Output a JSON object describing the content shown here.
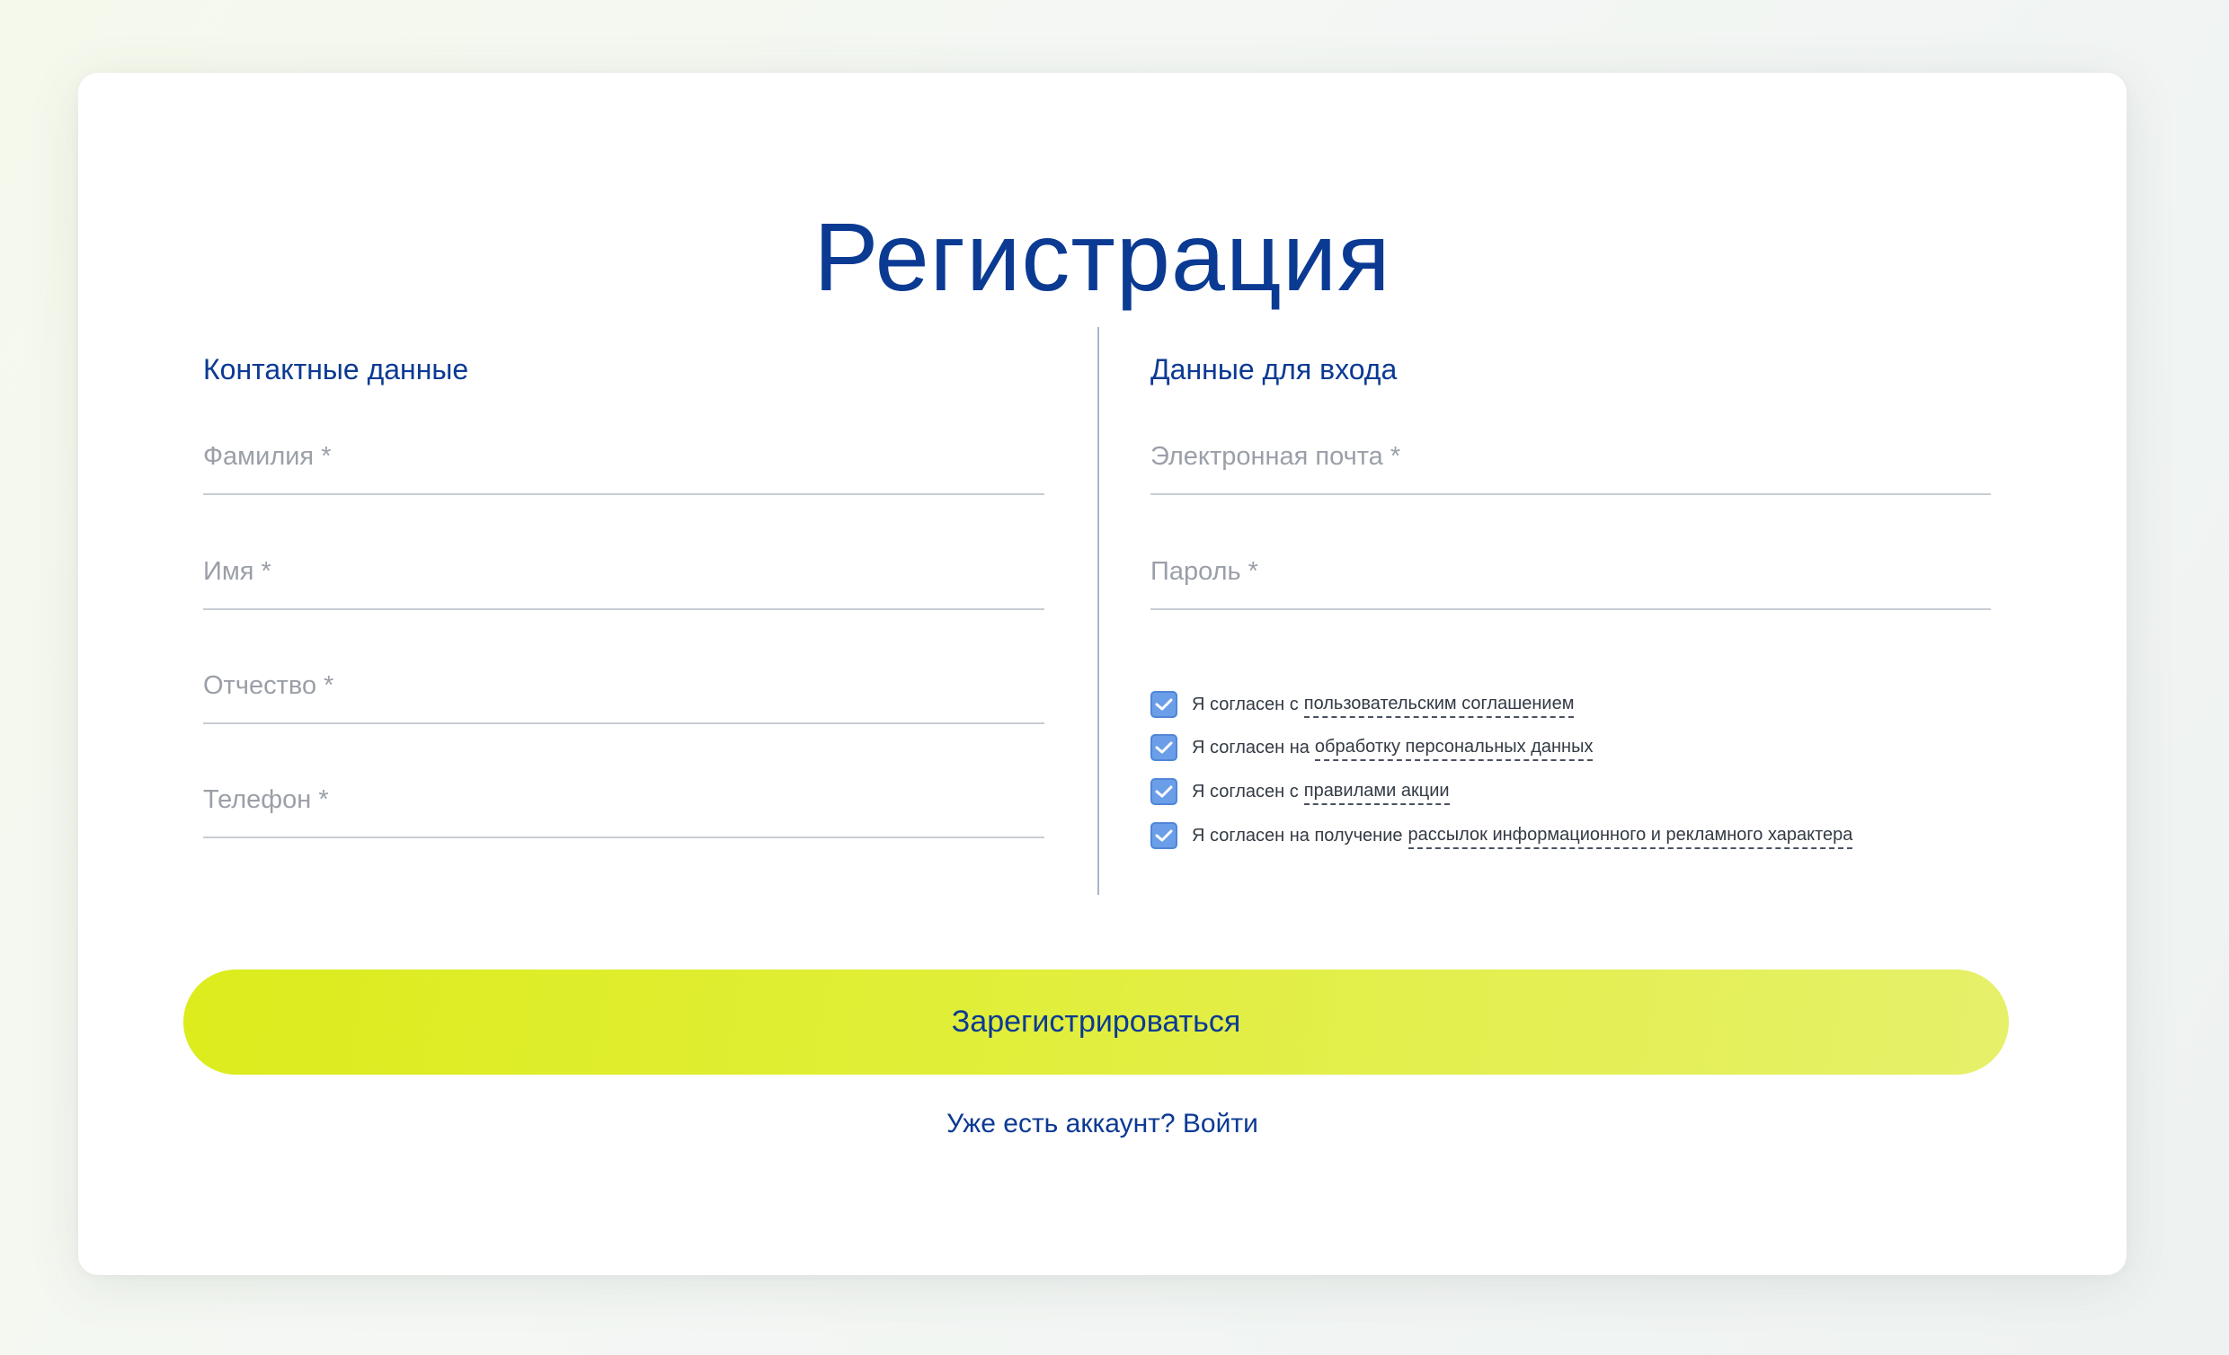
{
  "page": {
    "title": "Регистрация"
  },
  "contacts": {
    "heading": "Контактные данные",
    "fields": [
      {
        "placeholder": "Фамилия *",
        "value": ""
      },
      {
        "placeholder": "Имя *",
        "value": ""
      },
      {
        "placeholder": "Отчество *",
        "value": ""
      },
      {
        "placeholder": "Телефон *",
        "value": ""
      }
    ]
  },
  "login": {
    "heading": "Данные для входа",
    "fields": [
      {
        "placeholder": "Электронная почта *",
        "value": ""
      },
      {
        "placeholder": "Пароль *",
        "value": ""
      }
    ]
  },
  "agreements": [
    {
      "prefix": "Я согласен с",
      "link": "пользовательским соглашением",
      "checked": true
    },
    {
      "prefix": "Я согласен на",
      "link": "обработку персональных данных",
      "checked": true
    },
    {
      "prefix": "Я согласен с",
      "link": "правилами акции",
      "checked": true
    },
    {
      "prefix": "Я согласен на получение",
      "link": "рассылок информационного и рекламного характера",
      "checked": true
    }
  ],
  "actions": {
    "submit_label": "Зарегистрироваться",
    "login_link": "Уже есть аккаунт? Войти"
  },
  "colors": {
    "accent": "#0b3a93",
    "button": "#dcec1c",
    "checkbox": "#6b9ee8"
  },
  "icons": {
    "checkbox": "checkmark-icon"
  }
}
